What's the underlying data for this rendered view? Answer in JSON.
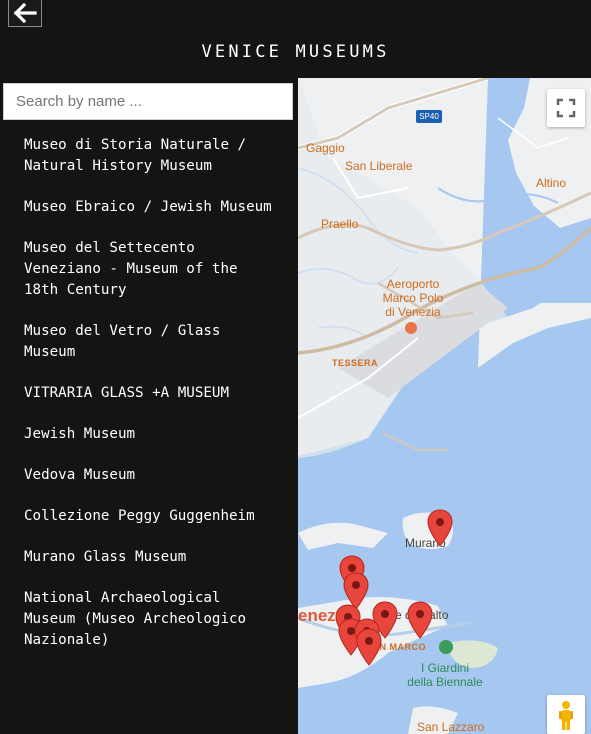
{
  "header": {
    "title": "VENICE MUSEUMS",
    "back_icon": "arrow-left-icon"
  },
  "search": {
    "placeholder": "Search by name ...",
    "value": ""
  },
  "museums": [
    "Museo di Storia Naturale / Natural History Museum",
    "Museo Ebraico / Jewish Museum",
    "Museo del Settecento Veneziano - Museum of the 18th Century",
    "Museo del Vetro / Glass Museum",
    "VITRARIA GLASS +A MUSEUM",
    "Jewish Museum",
    "Vedova Museum",
    "Collezione Peggy Guggenheim",
    "Murano Glass Museum",
    "National Archaeological Museum (Museo Archeologico Nazionale)"
  ],
  "map": {
    "labels": {
      "gaggio": "Gaggio",
      "san_liberale": "San Liberale",
      "altino": "Altino",
      "praello": "Praello",
      "airport": "Aeroporto\nMarco Polo\ndi Venezia",
      "tessera": "TESSERA",
      "murano": "Murano",
      "rialto": "e di Rialto",
      "venezia": "enez",
      "san_marco": "SAN MARCO",
      "giardini": "I Giardini\ndella Biennale",
      "san_lazzaro": "San Lazzaro",
      "road_shield": "SP40"
    },
    "colors": {
      "water": "#a5c7f0",
      "land": "#eef0f2",
      "road": "#d7c8b7",
      "marker": "#e8453c"
    },
    "controls": {
      "fullscreen_icon": "fullscreen-icon",
      "pegman_icon": "street-view-pegman-icon"
    }
  }
}
